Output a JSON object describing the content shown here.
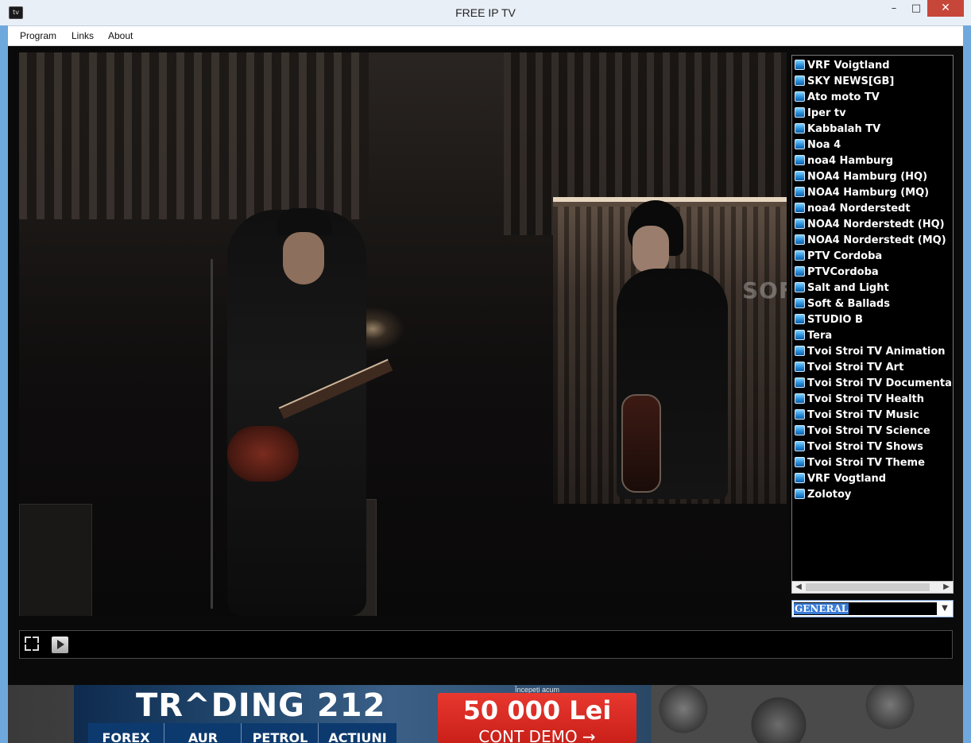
{
  "window": {
    "title": "FREE IP TV",
    "app_icon": "tv",
    "minimize": "–",
    "maximize": "□",
    "close": "✕"
  },
  "menu": {
    "items": [
      "Program",
      "Links",
      "About"
    ]
  },
  "video": {
    "watermark": "SOFTPEDIA"
  },
  "channels": [
    "VRF Voigtland",
    "SKY NEWS[GB]",
    "Ato moto TV",
    "Iper tv",
    "Kabbalah TV",
    "Noa 4",
    "noa4 Hamburg",
    "NOA4 Hamburg (HQ)",
    "NOA4 Hamburg (MQ)",
    "noa4 Norderstedt",
    "NOA4 Norderstedt (HQ)",
    "NOA4 Norderstedt (MQ)",
    "PTV Cordoba",
    "PTVCordoba",
    "Salt and Light",
    "Soft & Ballads",
    "STUDIO B",
    "Tera",
    "Tvoi Stroi TV Animation",
    "Tvoi Stroi TV Art",
    "Tvoi Stroi TV Documentar",
    "Tvoi Stroi TV Health",
    "Tvoi Stroi TV Music",
    "Tvoi Stroi TV Science",
    "Tvoi Stroi TV Shows",
    "Tvoi Stroi TV Theme",
    "VRF Vogtland",
    "Zolotoy"
  ],
  "scroll": {
    "left_arrow": "◀",
    "right_arrow": "▶"
  },
  "category": {
    "selected": "GENERAL",
    "arrow": "▼"
  },
  "ad": {
    "logo": "TR^DING 212",
    "start_text": "Începeți acum",
    "amount": "50 000 Lei",
    "demo": "CONT DEMO →",
    "tabs": [
      "FOREX",
      "AUR",
      "PETROL",
      "ACTIUNI"
    ]
  },
  "colors": {
    "accent_blue": "#3a7bd5",
    "close_red": "#c7463a",
    "ad_red": "#e8382f"
  }
}
